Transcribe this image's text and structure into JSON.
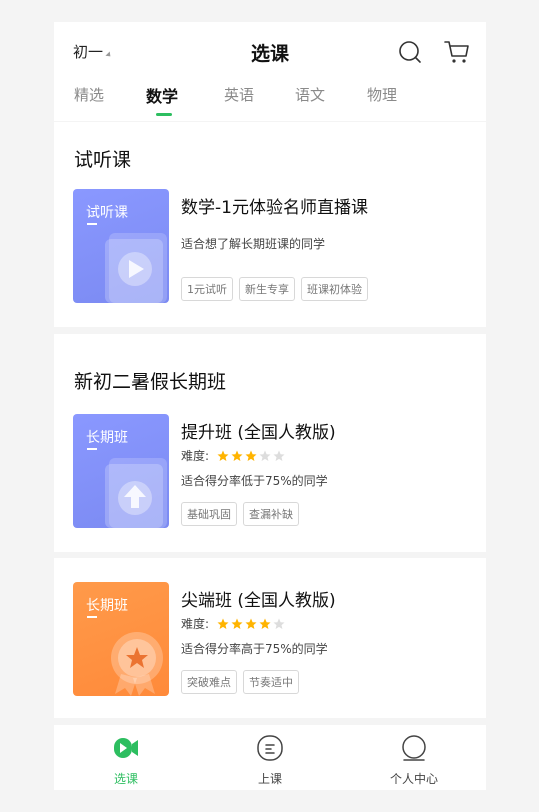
{
  "header": {
    "grade": "初一",
    "title": "选课"
  },
  "tabs": [
    {
      "label": "精选"
    },
    {
      "label": "数学"
    },
    {
      "label": "英语"
    },
    {
      "label": "语文"
    },
    {
      "label": "物理"
    }
  ],
  "active_tab": "数学",
  "trial_section": {
    "title": "试听课",
    "course": {
      "thumb_label": "试听课",
      "name": "数学-1元体验名师直播课",
      "desc": "适合想了解长期班课的同学",
      "tags": [
        "1元试听",
        "新生专享",
        "班课初体验"
      ]
    }
  },
  "long_section": {
    "title": "新初二暑假长期班",
    "course1": {
      "thumb_label": "长期班",
      "name": "提升班 (全国人教版)",
      "difficulty_label": "难度:",
      "difficulty": 3,
      "difficulty_max": 5,
      "desc": "适合得分率低于75%的同学",
      "tags": [
        "基础巩固",
        "查漏补缺"
      ]
    }
  },
  "course2": {
    "thumb_label": "长期班",
    "name": "尖端班 (全国人教版)",
    "difficulty_label": "难度:",
    "difficulty": 4,
    "difficulty_max": 5,
    "desc": "适合得分率高于75%的同学",
    "tags": [
      "突破难点",
      "节奏适中"
    ]
  },
  "bottom_nav": [
    {
      "label": "选课",
      "icon": "video-icon"
    },
    {
      "label": "上课",
      "icon": "lesson-icon"
    },
    {
      "label": "个人中心",
      "icon": "user-icon"
    }
  ],
  "colors": {
    "accent": "#2dbe60",
    "star_on": "#ffb400",
    "star_off": "#dddddd",
    "thumb_blue": "#8a98ff",
    "thumb_orange": "#ff9a4a"
  }
}
